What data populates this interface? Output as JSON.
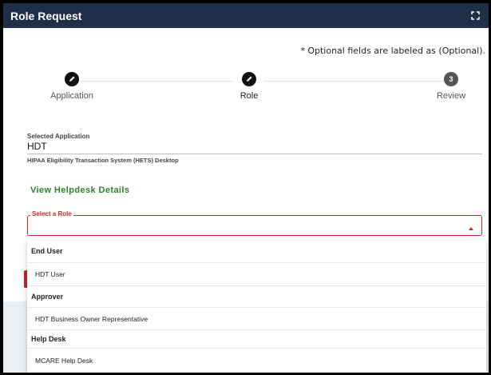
{
  "window": {
    "title": "Role Request"
  },
  "optional_note": "* Optional fields are labeled as (Optional).",
  "steps": [
    {
      "label": "Application",
      "icon": "pencil-icon"
    },
    {
      "label": "Role",
      "icon": "pencil-icon"
    },
    {
      "label": "Review",
      "number": "3"
    }
  ],
  "selected_application": {
    "caption": "Selected Application",
    "value": "HDT",
    "description": "HIPAA Eligibility Transaction System (HETS) Desktop"
  },
  "helpdesk_link": "View Helpdesk Details",
  "role_select": {
    "label": "Select a Role"
  },
  "dropdown": {
    "groups": [
      {
        "name": "End User",
        "items": [
          "HDT User"
        ]
      },
      {
        "name": "Approver",
        "items": [
          "HDT Business Owner Representative"
        ]
      },
      {
        "name": "Help Desk",
        "items": [
          "MCARE Help Desk"
        ]
      }
    ]
  },
  "colors": {
    "header": "#1f2f48",
    "error": "#c62828",
    "link": "#2e7d32"
  }
}
